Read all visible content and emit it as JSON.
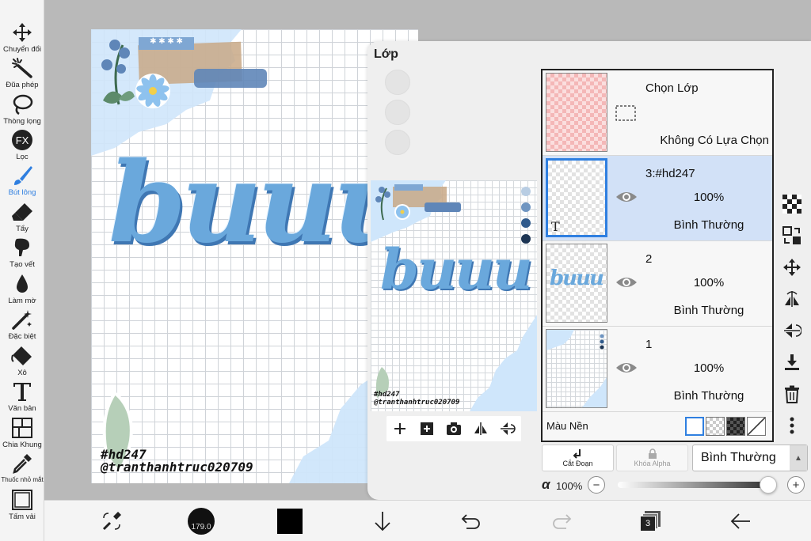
{
  "toolbar": {
    "tools": [
      {
        "label": "Chuyển đổi",
        "icon": "move-icon",
        "active": false
      },
      {
        "label": "Đũa phép",
        "icon": "magic-wand-icon",
        "active": false
      },
      {
        "label": "Thòng lọng",
        "icon": "lasso-icon",
        "active": false
      },
      {
        "label": "Lọc",
        "icon": "fx-filter-icon",
        "active": false
      },
      {
        "label": "Bút lông",
        "icon": "brush-icon",
        "active": true
      },
      {
        "label": "Tẩy",
        "icon": "eraser-icon",
        "active": false
      },
      {
        "label": "Tạo vết",
        "icon": "smudge-icon",
        "active": false
      },
      {
        "label": "Làm mờ",
        "icon": "blur-drop-icon",
        "active": false
      },
      {
        "label": "Đặc biệt",
        "icon": "special-pen-icon",
        "active": false
      },
      {
        "label": "Xô",
        "icon": "bucket-icon",
        "active": false
      },
      {
        "label": "Văn bản",
        "icon": "text-icon",
        "active": false
      },
      {
        "label": "Chia Khung",
        "icon": "frame-divider-icon",
        "active": false
      },
      {
        "label": "Thuốc nhỏ mắt",
        "icon": "eyedropper-icon",
        "active": false
      },
      {
        "label": "Tấm vải",
        "icon": "canvas-icon",
        "active": false
      }
    ],
    "fx_text": "FX"
  },
  "canvas": {
    "text_art": "buuu",
    "tag_line": "#hd247",
    "credit_line": "@tranthanhtruc020709",
    "tape_text": "✱ ✱ ✱ ✱"
  },
  "layer_panel": {
    "title": "Lớp",
    "selection_row": {
      "name": "Chọn Lớp",
      "status": "Không Có Lựa Chọn"
    },
    "layers": [
      {
        "name": "3:#hd247",
        "opacity": "100%",
        "mode": "Bình Thường",
        "selected": true,
        "thumb_mark": "T"
      },
      {
        "name": "2",
        "opacity": "100%",
        "mode": "Bình Thường",
        "selected": false
      },
      {
        "name": "1",
        "opacity": "100%",
        "mode": "Bình Thường",
        "selected": false
      }
    ],
    "background_label": "Màu Nền",
    "clipping_label": "Cắt Đoạn",
    "alpha_lock_label": "Khóa Alpha",
    "blend_mode": "Bình Thường",
    "alpha_symbol": "α",
    "opacity_value": "100%",
    "opacity_level": 1.0,
    "minus": "−",
    "plus": "+"
  },
  "bottombar": {
    "brush_size": "179.0",
    "layer_count": "3",
    "primary_color": "#000000"
  },
  "colors": {
    "accent": "#2f7fe0",
    "selected_row": "#d2e1f7",
    "art_blue": "#6aa8dc",
    "torn_paper_blue": "#cfe6fb"
  }
}
